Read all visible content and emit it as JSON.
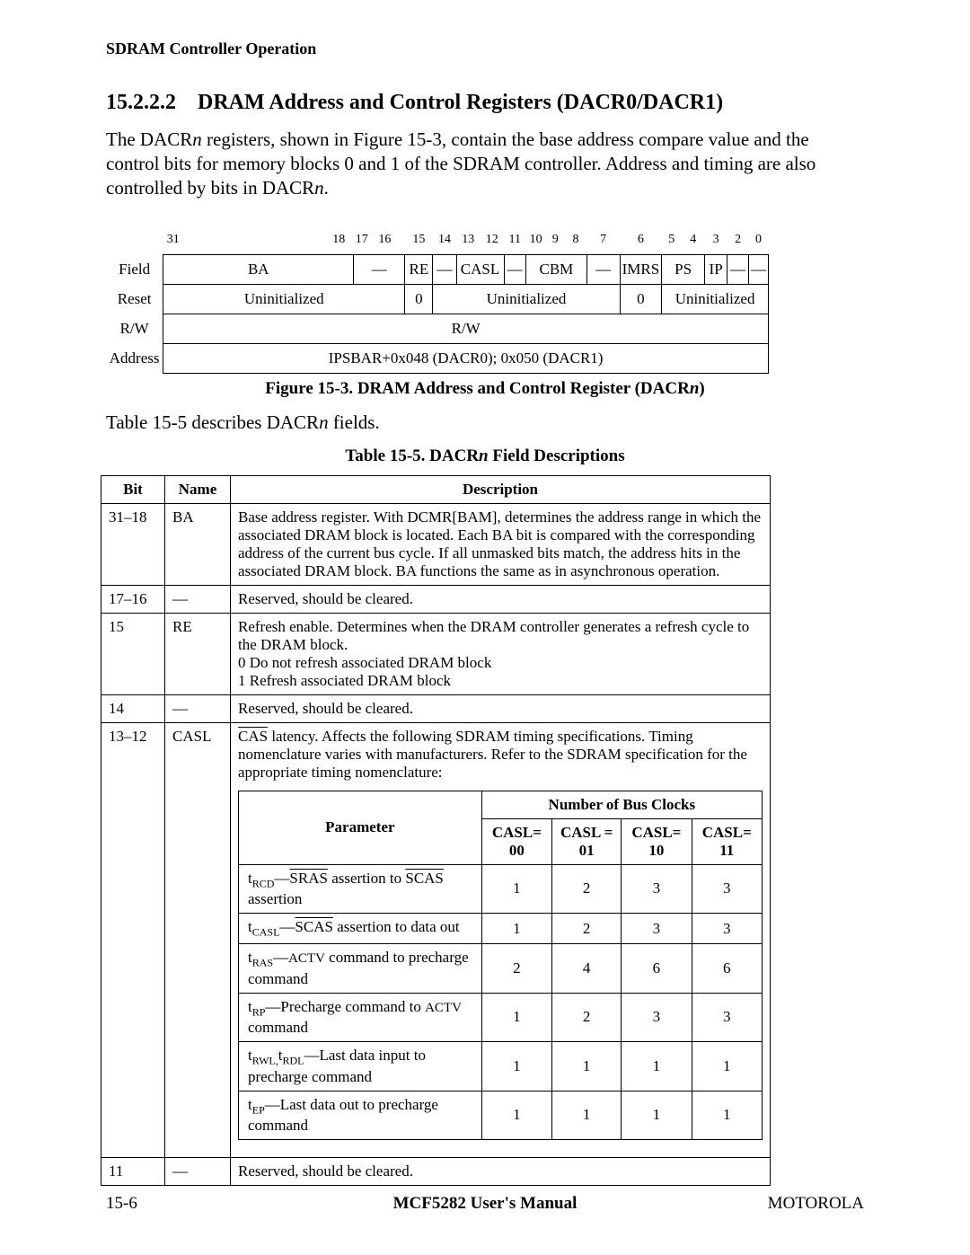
{
  "header": "SDRAM Controller Operation",
  "section": {
    "number": "15.2.2.2",
    "title": "DRAM Address and Control Registers (DACR0/DACR1)"
  },
  "para1_a": "The DACR",
  "para1_b": " registers, shown in Figure 15-3, contain the base address compare value and the control bits for memory blocks 0 and 1 of the SDRAM controller. Address and timing are also controlled by bits in DACR",
  "n": "n",
  "period": ".",
  "reg": {
    "bits": {
      "b31": "31",
      "b18": "18",
      "b17": "17",
      "b16": "16",
      "b15": "15",
      "b14": "14",
      "b13": "13",
      "b12": "12",
      "b11": "11",
      "b10": "10",
      "b9": "9",
      "b8": "8",
      "b7": "7",
      "b6": "6",
      "b5": "5",
      "b4": "4",
      "b3": "3",
      "b2": "2",
      "b0": "0"
    },
    "rowlabels": {
      "field": "Field",
      "reset": "Reset",
      "rw": "R/W",
      "address": "Address"
    },
    "fields": {
      "ba": "BA",
      "dash": "—",
      "re": "RE",
      "casl": "CASL",
      "cbm": "CBM",
      "imrs": "IMRS",
      "ps": "PS",
      "ip": "IP"
    },
    "reset": {
      "uninit": "Uninitialized",
      "zero": "0"
    },
    "rw": "R/W",
    "address": "IPSBAR+0x048 (DACR0); 0x050 (DACR1)"
  },
  "fig_caption_a": "Figure 15-3. DRAM Address and Control Register (DACR",
  "fig_caption_b": ")",
  "line2_a": "Table 15-5 describes DACR",
  "line2_b": " fields.",
  "table_caption_a": "Table 15-5. DACR",
  "table_caption_b": " Field Descriptions",
  "desc": {
    "head": {
      "bit": "Bit",
      "name": "Name",
      "desc": "Description"
    },
    "rows": [
      {
        "bit": "31–18",
        "name": "BA",
        "desc": "Base address register. With DCMR[BAM], determines the address range in which the associated DRAM block is located. Each BA bit is compared with the corresponding address of the current bus cycle. If all unmasked bits match, the address hits in the associated DRAM block. BA functions the same as in asynchronous operation."
      },
      {
        "bit": "17–16",
        "name": "—",
        "desc": "Reserved, should be cleared."
      },
      {
        "bit": "15",
        "name": "RE",
        "desc": "Refresh enable. Determines when the DRAM controller generates a refresh cycle to the DRAM block.\n0   Do not refresh associated DRAM block\n1   Refresh associated DRAM block"
      },
      {
        "bit": "14",
        "name": "—",
        "desc": "Reserved, should be cleared."
      },
      {
        "bit": "13–12",
        "name": "CASL",
        "desc": ""
      },
      {
        "bit": "11",
        "name": "—",
        "desc": "Reserved, should be cleared."
      }
    ],
    "casl_intro_a": "CAS",
    "casl_intro_b": " latency. Affects the following SDRAM timing specifications. Timing nomenclature varies with manufacturers. Refer to the SDRAM specification for the appropriate timing nomenclature:",
    "inner": {
      "param_head": "Parameter",
      "nbc_head": "Number of Bus Clocks",
      "cols": {
        "c00": "CASL= 00",
        "c01": "CASL = 01",
        "c10": "CASL= 10",
        "c11": "CASL= 11"
      },
      "params": [
        {
          "sym": "t",
          "sub": "RCD",
          "before": "—",
          "ovl1": "SRAS",
          "mid": " assertion to ",
          "ovl2": "SCAS",
          "after": " assertion",
          "v": [
            "1",
            "2",
            "3",
            "3"
          ]
        },
        {
          "sym": "t",
          "sub": "CASL",
          "before": "—",
          "ovl1": "SCAS",
          "mid": " assertion to data out",
          "ovl2": "",
          "after": "",
          "v": [
            "1",
            "2",
            "3",
            "3"
          ]
        },
        {
          "sym": "t",
          "sub": "RAS",
          "before": "—",
          "text": "ACTV command to precharge command",
          "v": [
            "2",
            "4",
            "6",
            "6"
          ]
        },
        {
          "sym": "t",
          "sub": "RP",
          "before": "—",
          "text": "Precharge command to ACTV command",
          "v": [
            "1",
            "2",
            "3",
            "3"
          ]
        },
        {
          "sym2": "t",
          "sub2a": "RWL,",
          "sub2b": "RDL",
          "before": "—",
          "text": "Last data input to precharge command",
          "v": [
            "1",
            "1",
            "1",
            "1"
          ]
        },
        {
          "sym": "t",
          "sub": "EP",
          "before": "—",
          "text": "Last data out to precharge command",
          "v": [
            "1",
            "1",
            "1",
            "1"
          ]
        }
      ]
    }
  },
  "footer": {
    "left": "15-6",
    "center": "MCF5282 User's Manual",
    "right": "MOTOROLA"
  }
}
